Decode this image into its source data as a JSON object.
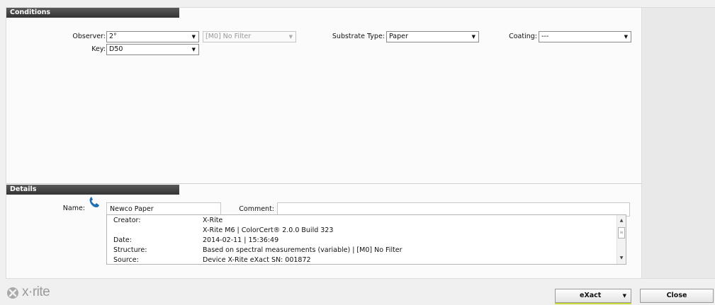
{
  "conditions": {
    "title": "Conditions",
    "observer_label": "Observer:",
    "observer_value": "2°",
    "filter_value": "[M0] No Filter",
    "key_label": "Key:",
    "key_value": "D50",
    "substrate_label": "Substrate Type:",
    "substrate_value": "Paper",
    "coating_label": "Coating:",
    "coating_value": "---"
  },
  "details": {
    "title": "Details",
    "name_label": "Name:",
    "name_value": "Newco Paper",
    "comment_label": "Comment:",
    "comment_value": "",
    "info_rows": [
      {
        "key": "Creator:",
        "value": "X-Rite"
      },
      {
        "key": "",
        "value": "X-Rite M6 | ColorCert® 2.0.0 Build 323"
      },
      {
        "key": "Date:",
        "value": "2014-02-11 | 15:36:49"
      },
      {
        "key": "Structure:",
        "value": "Based on spectral measurements (variable) | [M0] No Filter"
      },
      {
        "key": "Source:",
        "value": "Device X-Rite eXact SN: 001872"
      }
    ]
  },
  "footer": {
    "logo_text": "x·rite",
    "device_button": "eXact",
    "close_button": "Close"
  },
  "icons": {
    "phone": "phone-icon",
    "logo": "xrite-logo-icon",
    "dropdown": "chevron-down-icon"
  },
  "colors": {
    "section_header": "#3f3f3f",
    "phone_icon": "#1e6fb3",
    "device_button_accent": "#c8d838"
  }
}
